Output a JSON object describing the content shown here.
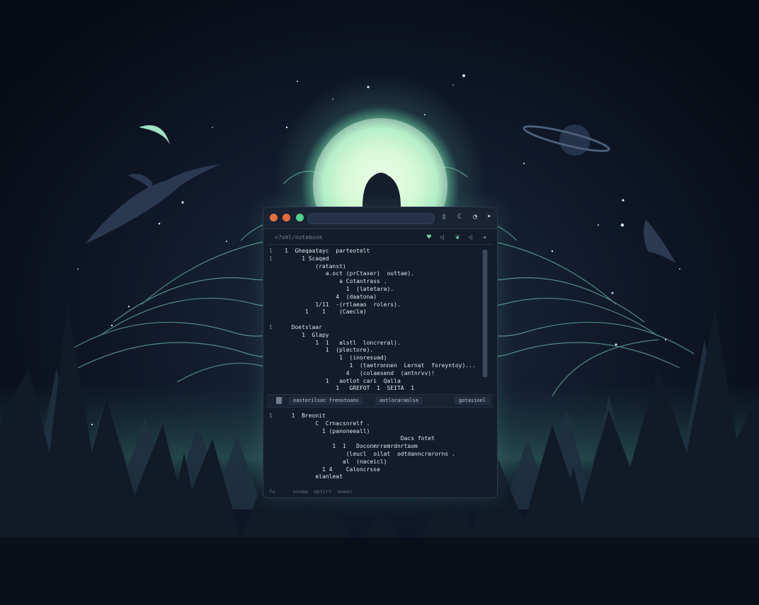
{
  "window": {
    "toolbar_icons": [
      "tab-icon",
      "moon-icon",
      "user-icon",
      "send-icon"
    ],
    "file_label": "<?xml/notebook",
    "tool_icons": [
      "heart-icon",
      "send-icon",
      "leaf-icon",
      "send-icon",
      "arrow-icon"
    ]
  },
  "editor": {
    "top_lines": [
      {
        "gutter": "1",
        "text": "1  Gheqaatayc  parteotelt"
      },
      {
        "gutter": "1",
        "text": "     1 Scaqed"
      },
      {
        "gutter": "",
        "text": "         (ratanst)"
      },
      {
        "gutter": "",
        "text": "            a.oct (prCtaxer)  outtae)."
      },
      {
        "gutter": "",
        "text": "                a Cotantrass ."
      },
      {
        "gutter": "",
        "text": "                  1  (latetara)."
      },
      {
        "gutter": "",
        "text": "               4  (daatona)"
      },
      {
        "gutter": "",
        "text": "         1/11  -(rtlaeao  rolers)."
      },
      {
        "gutter": "",
        "text": "      1    1    (Caecla)"
      },
      {
        "gutter": "",
        "text": ""
      },
      {
        "gutter": "1",
        "text": "  Doetslaar"
      },
      {
        "gutter": "",
        "text": "     1  Glapy"
      },
      {
        "gutter": "",
        "text": "         1  1   alstl  loncreral)."
      },
      {
        "gutter": "",
        "text": "            1  (plectore)."
      },
      {
        "gutter": "",
        "text": "                1  (inoresuad)"
      },
      {
        "gutter": "",
        "text": "                   1  (taetronnen  Lernat  foreyntoy)..."
      },
      {
        "gutter": "",
        "text": "                  4   (colaesend  (antnrvv)!"
      },
      {
        "gutter": "",
        "text": "            1   aotlot cari  Qalla"
      },
      {
        "gutter": "",
        "text": "               1   GREFOT  1  SEITA  1"
      }
    ],
    "panel_tabs": [
      "oasterilsac  frenstoans",
      "aotloraraolsa",
      "gotasinel"
    ],
    "bottom_lines": [
      {
        "gutter": "1",
        "text": "  1  Breonit"
      },
      {
        "gutter": "",
        "text": "         C  Crnacsnrelf ."
      },
      {
        "gutter": "",
        "text": "           1 (panoneeall)"
      },
      {
        "gutter": "",
        "text": "                                  Dacs fotet"
      },
      {
        "gutter": "",
        "text": "              1  1   Doconmrremrdnrtaom"
      },
      {
        "gutter": "",
        "text": "                  (leucl  oilat  odtdanncrarorns ."
      },
      {
        "gutter": "",
        "text": "                 al  (naceicl)"
      },
      {
        "gutter": "",
        "text": "           1 4    Caloncrsse"
      },
      {
        "gutter": "",
        "text": "         elanleat"
      }
    ],
    "status": "fo      ooaaa  aptirr  aaaa)"
  }
}
